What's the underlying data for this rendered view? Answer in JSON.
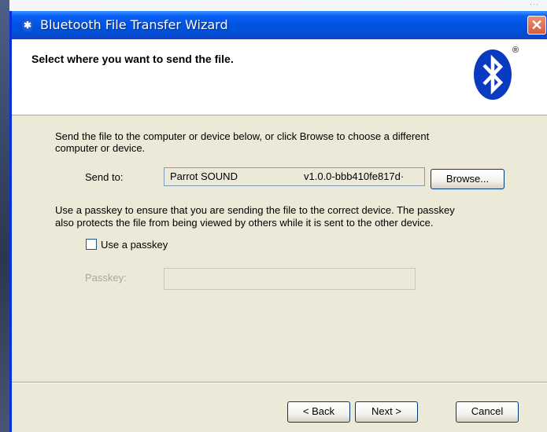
{
  "window": {
    "title": "Bluetooth File Transfer Wizard",
    "close_glyph": "✕",
    "title_icon": "bluetooth-icon"
  },
  "header": {
    "title": "Select where you want to send the file.",
    "logo": "bluetooth-logo",
    "registered_mark": "®"
  },
  "main": {
    "intro_line1": "Send the file to the computer or device below, or click Browse to choose a different",
    "intro_line2": "computer or device.",
    "send_to_label": "Send to:",
    "send_to_value_name": "Parrot SOUND",
    "send_to_value_id": "v1.0.0-bbb410fe817d·",
    "browse_label": "Browse...",
    "passkey_info_line1": "Use a passkey to ensure that you are sending the file to the correct device. The passkey",
    "passkey_info_line2": "also protects the file from being viewed by others while it is sent to the other device.",
    "use_passkey_label": "Use a passkey",
    "use_passkey_checked": false,
    "passkey_label": "Passkey:",
    "passkey_value": ""
  },
  "footer": {
    "back_label": "< Back",
    "next_label": "Next >",
    "cancel_label": "Cancel"
  },
  "colors": {
    "titlebar": "#0054e3",
    "dialog_bg": "#ece9d8",
    "close_button": "#d65e3e"
  }
}
